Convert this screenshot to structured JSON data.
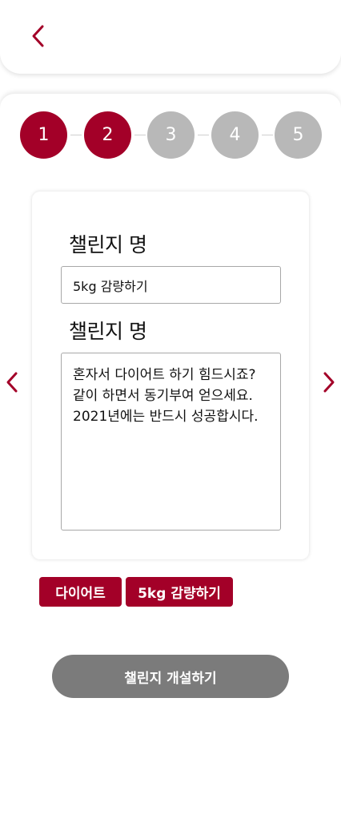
{
  "header": {
    "back_icon": "chevron-left-icon"
  },
  "stepper": {
    "steps": [
      {
        "label": "1",
        "state": "active"
      },
      {
        "label": "2",
        "state": "active"
      },
      {
        "label": "3",
        "state": "inactive"
      },
      {
        "label": "4",
        "state": "inactive"
      },
      {
        "label": "5",
        "state": "inactive"
      }
    ]
  },
  "form": {
    "name_label": "챌린지 명",
    "name_value": "5kg 감량하기",
    "desc_label": "챌린지 명",
    "desc_value": "혼자서 다이어트 하기 힘드시죠?\n같이 하면서 동기부여 얻으세요.\n2021년에는 반드시 성공합시다."
  },
  "tags": [
    "다이어트",
    "5kg 감량하기"
  ],
  "submit_label": "챌린지 개설하기",
  "colors": {
    "accent": "#a30028",
    "inactive_step": "#b8b8b8",
    "submit_bg": "#7b7b7b"
  }
}
